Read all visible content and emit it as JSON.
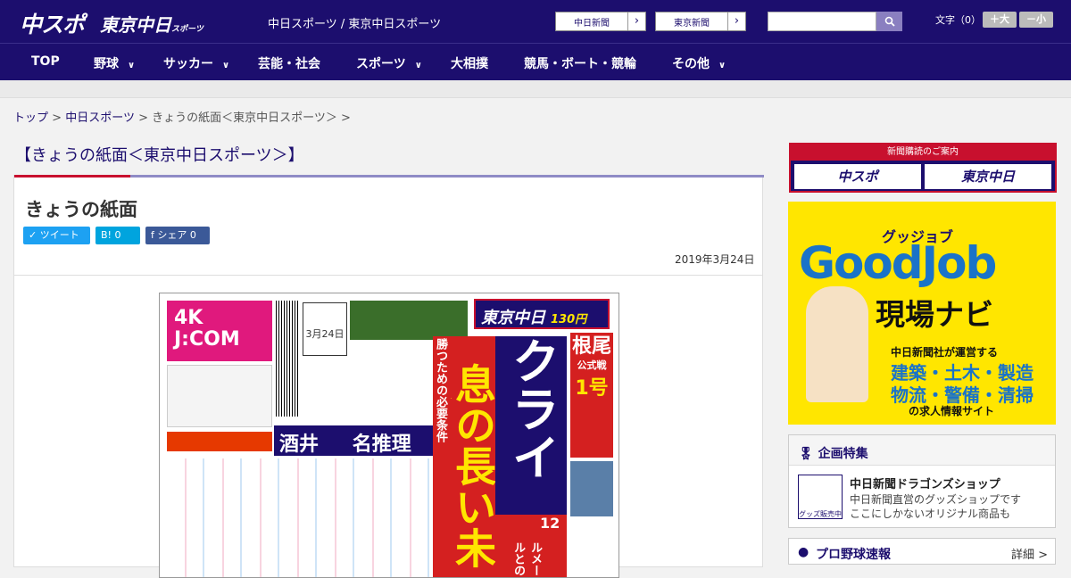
{
  "header": {
    "logo1": "中スポ",
    "logo2": "東京中日",
    "logo2_small": "スポーツ",
    "site_link": "中日スポーツ / 東京中日スポーツ",
    "papers": [
      "中日新聞",
      "東京新聞"
    ],
    "font_label": "文字（0）",
    "font_larger": "＋大",
    "font_smaller": "－小",
    "search_placeholder": ""
  },
  "nav": [
    "TOP",
    "野球",
    "サッカー",
    "芸能・社会",
    "スポーツ",
    "大相撲",
    "競馬・ボート・競輪",
    "その他"
  ],
  "breadcrumb": {
    "home": "トップ",
    "section": "中日スポーツ",
    "current": "きょうの紙面＜東京中日スポーツ＞ >",
    "sep": ">"
  },
  "heading": "【きょうの紙面＜東京中日スポーツ＞】",
  "article": {
    "title": "きょうの紙面",
    "tweet": "ツイート",
    "hatena": "B! 0",
    "share": "シェア 0",
    "date": "2019年3月24日"
  },
  "newspaper": {
    "masthead": "東京中日",
    "price": "130円",
    "headline": "クライ",
    "headline2": "息の長い未来",
    "sub": "勝つための必要条件",
    "side": "根尾",
    "side2": "公式戦",
    "side3": "1号",
    "jcom": "4K J:COM",
    "sakai": "酒井",
    "meisuiri": "名推理",
    "date": "3月24日",
    "number": "12",
    "rumeru": "ルメールとの"
  },
  "sidebar": {
    "subscribe": "新聞購読のご案内",
    "sub_left": "中スポ",
    "sub_right": "東京中日",
    "gj_small": "グッジョブ",
    "gj_big": "GoodJob",
    "gj_nav": "現場ナビ",
    "gj_line1": "中日新聞社が運営する",
    "gj_line2": "建築・土木・製造",
    "gj_line3": "物流・警備・清掃",
    "gj_line4": "の求人情報サイト",
    "special_head": "企画特集",
    "special_title": "中日新聞ドラゴンズショップ",
    "special_desc1": "中日新聞直営のグッズショップです",
    "special_desc2": "ここにしかないオリジナル商品も",
    "icon_label": "グッズ販売中",
    "baseball": "プロ野球速報",
    "baseball_more": "詳細 >"
  },
  "colors": {
    "brand": "#1c0e6e",
    "accent": "#c8102e"
  }
}
